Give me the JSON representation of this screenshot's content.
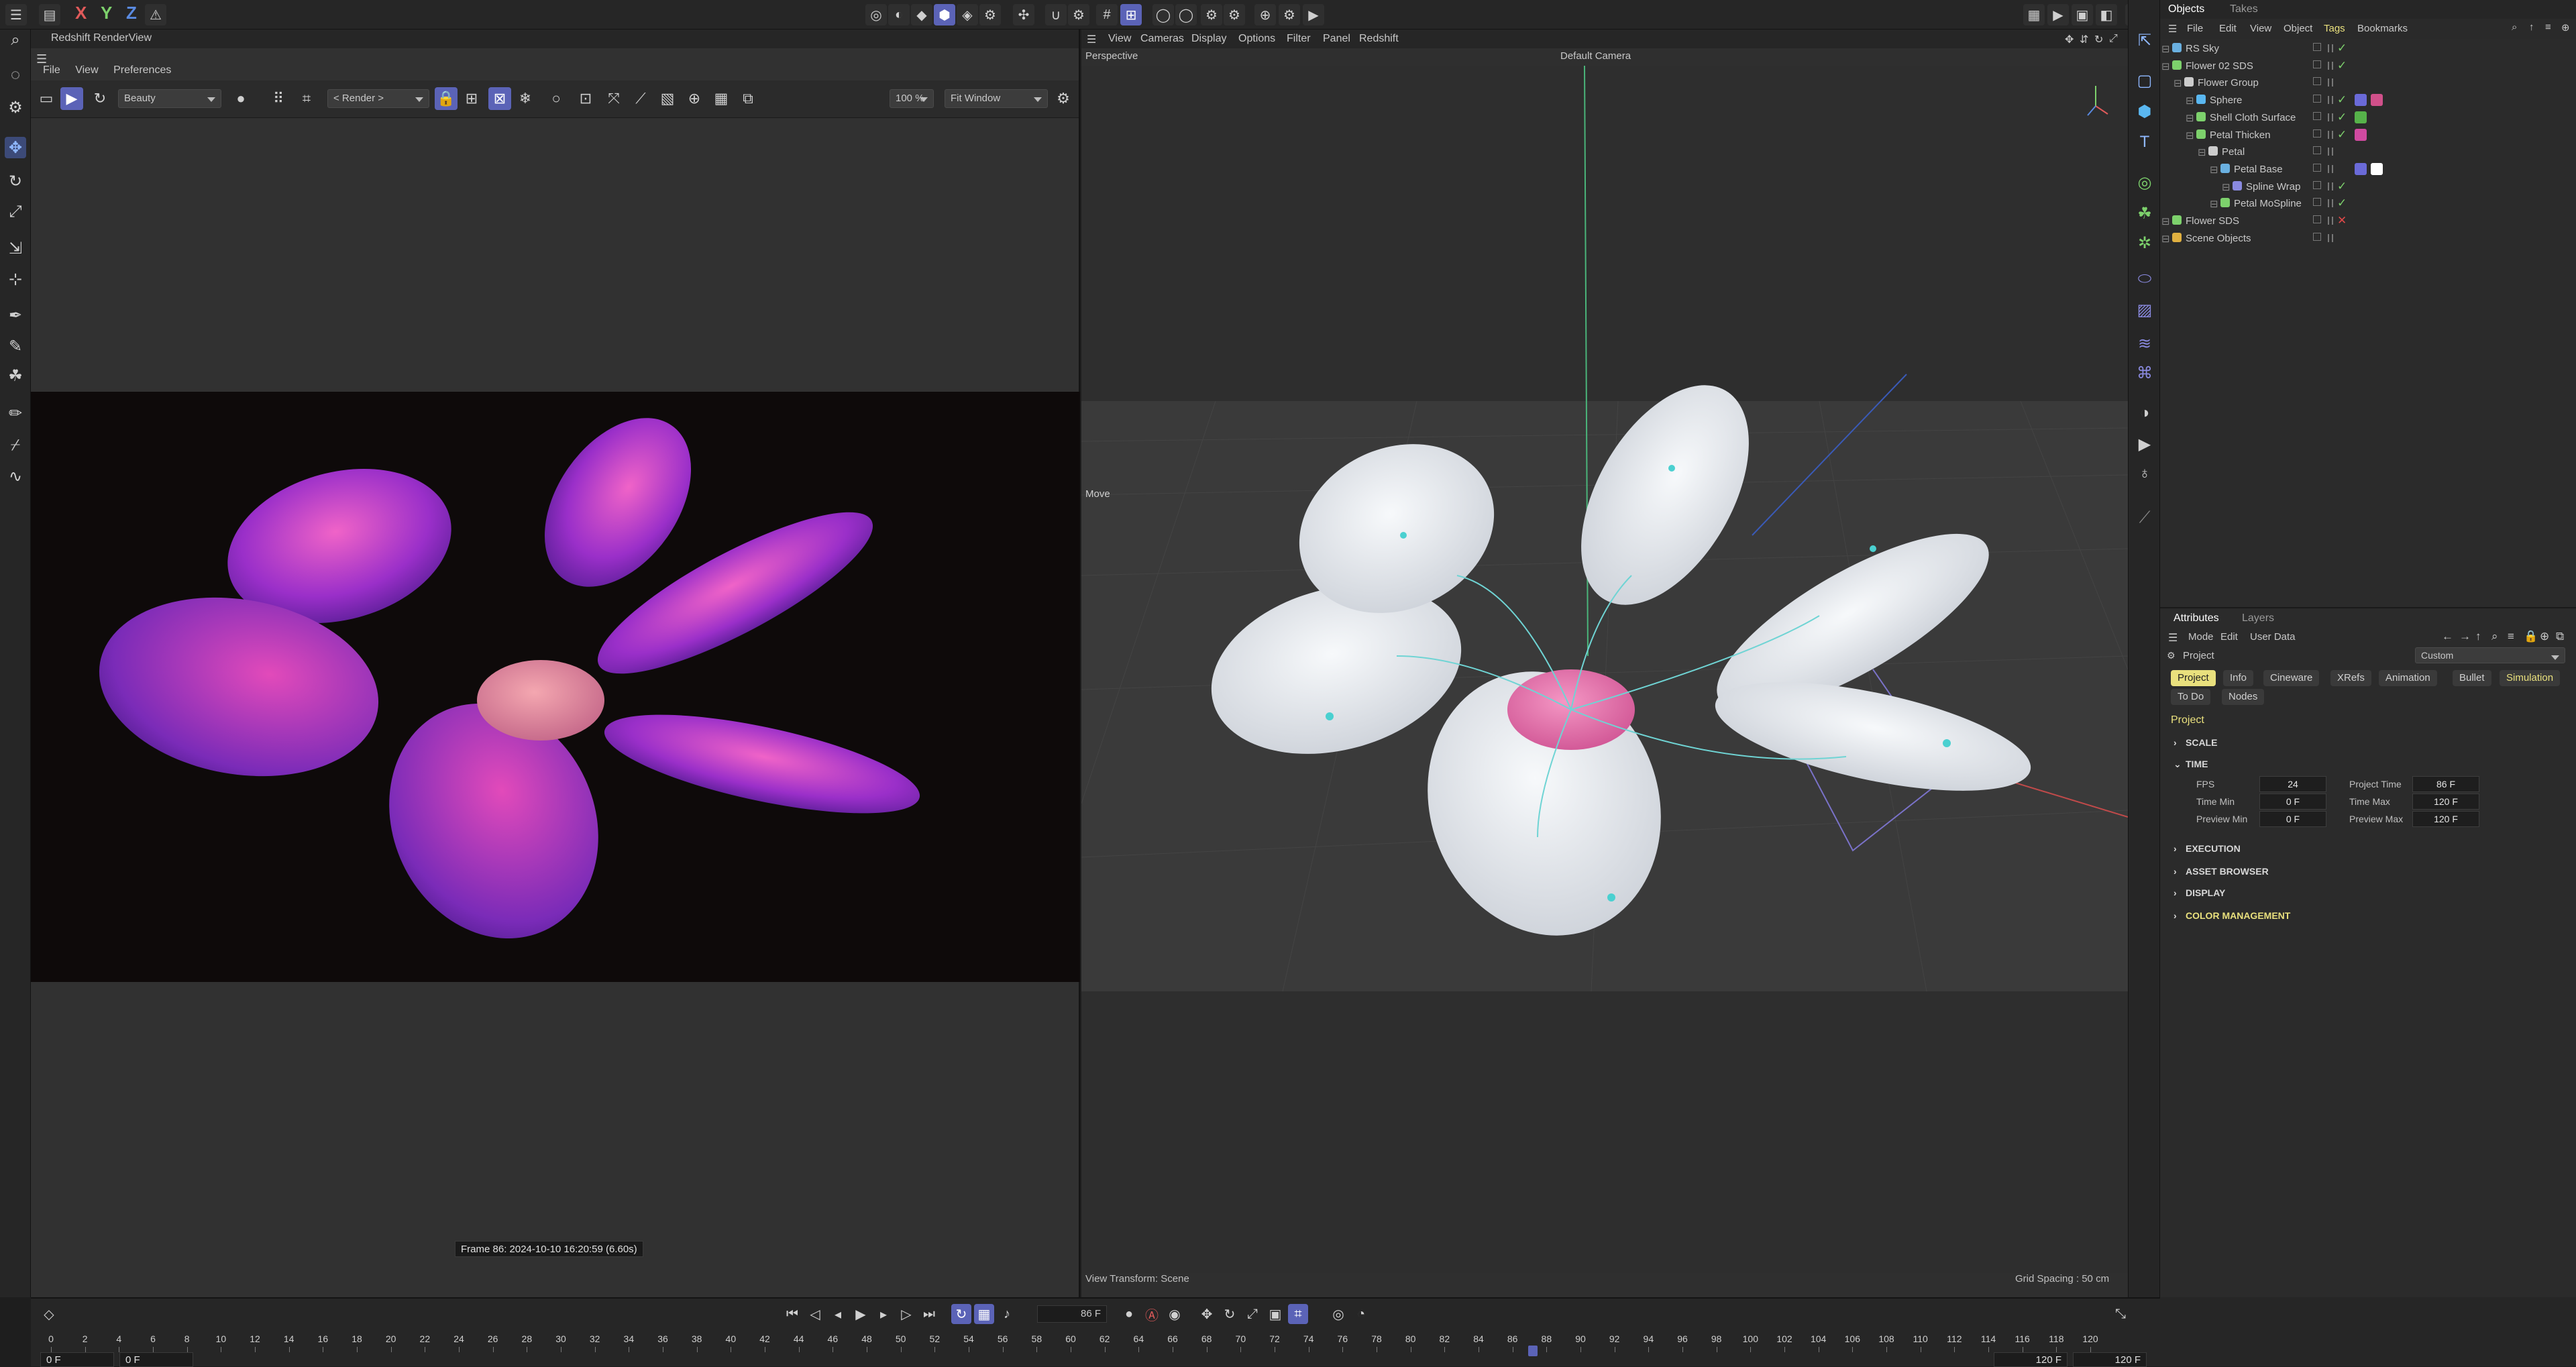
{
  "top": {
    "axis_x": "X",
    "axis_y": "Y",
    "axis_z": "Z"
  },
  "renderview": {
    "title": "Redshift RenderView",
    "menu": [
      "File",
      "View",
      "Preferences"
    ],
    "pass_select": "Beauty",
    "render_select": "< Render >",
    "zoom": "100 %",
    "fit_select": "Fit Window",
    "frame_status": "Frame  86:  2024-10-10  16:20:59  (6.60s)"
  },
  "viewport": {
    "menu": [
      "View",
      "Cameras",
      "Display",
      "Options",
      "Filter",
      "Panel",
      "Redshift"
    ],
    "projection": "Perspective",
    "camera": "Default Camera",
    "move_label": "Move",
    "view_transform": "View Transform: Scene",
    "grid_spacing": "Grid Spacing : 50 cm"
  },
  "objects": {
    "tabs": [
      "Objects",
      "Takes"
    ],
    "menu": [
      "File",
      "Edit",
      "View",
      "Object",
      "Tags",
      "Bookmarks"
    ],
    "rows": [
      {
        "name": "RS Sky",
        "indent": 0,
        "color": "#6ab0e0",
        "status": "check"
      },
      {
        "name": "Flower 02 SDS",
        "indent": 0,
        "color": "#7dd16c",
        "status": "check"
      },
      {
        "name": "Flower Group",
        "indent": 1,
        "color": "#cccccc",
        "status": "none"
      },
      {
        "name": "Sphere",
        "indent": 2,
        "color": "#5ab7f0",
        "status": "check",
        "tags": [
          "#6a6ad8",
          "#d0508a"
        ]
      },
      {
        "name": "Shell Cloth Surface",
        "indent": 2,
        "color": "#7dd16c",
        "status": "check",
        "tags": [
          "#56b24a"
        ]
      },
      {
        "name": "Petal Thicken",
        "indent": 2,
        "color": "#7dd16c",
        "status": "check",
        "tags": [
          "#d04aa0"
        ]
      },
      {
        "name": "Petal",
        "indent": 3,
        "color": "#cccccc",
        "status": "none"
      },
      {
        "name": "Petal Base",
        "indent": 4,
        "color": "#6ab0e0",
        "status": "none",
        "tags": [
          "#6a6ad8",
          "#ffffff"
        ]
      },
      {
        "name": "Spline Wrap",
        "indent": 5,
        "color": "#8a8ae0",
        "status": "check"
      },
      {
        "name": "Petal MoSpline",
        "indent": 4,
        "color": "#7dd16c",
        "status": "check"
      },
      {
        "name": "Flower SDS",
        "indent": 0,
        "color": "#7dd16c",
        "status": "x"
      },
      {
        "name": "Scene Objects",
        "indent": 0,
        "color": "#e0b040",
        "status": "none"
      }
    ]
  },
  "attributes": {
    "tabs": [
      "Attributes",
      "Layers"
    ],
    "menu": [
      "Mode",
      "Edit",
      "User Data"
    ],
    "object_label": "Project",
    "preset": "Custom",
    "chips": [
      "Project",
      "Info",
      "Cineware",
      "XRefs",
      "Animation",
      "Bullet",
      "Simulation",
      "To Do",
      "Nodes"
    ],
    "section_title": "Project",
    "sections": [
      "SCALE",
      "TIME",
      "EXECUTION",
      "ASSET BROWSER",
      "DISPLAY",
      "COLOR MANAGEMENT"
    ],
    "time": {
      "fps_label": "FPS",
      "fps": "24",
      "project_time_label": "Project Time",
      "project_time": "86 F",
      "time_min_label": "Time Min",
      "time_min": "0 F",
      "time_max_label": "Time Max",
      "time_max": "120 F",
      "preview_min_label": "Preview Min",
      "preview_min": "0 F",
      "preview_max_label": "Preview Max",
      "preview_max": "120 F"
    }
  },
  "timeline": {
    "current_frame": "86 F",
    "ticks": [
      "0",
      "2",
      "4",
      "6",
      "8",
      "10",
      "12",
      "14",
      "16",
      "18",
      "20",
      "22",
      "24",
      "26",
      "28",
      "30",
      "32",
      "34",
      "36",
      "38",
      "40",
      "42",
      "44",
      "46",
      "48",
      "50",
      "52",
      "54",
      "56",
      "58",
      "60",
      "62",
      "64",
      "66",
      "68",
      "70",
      "72",
      "74",
      "76",
      "78",
      "80",
      "82",
      "84",
      "86",
      "88",
      "90",
      "92",
      "94",
      "96",
      "98",
      "100",
      "102",
      "104",
      "106",
      "108",
      "110",
      "112",
      "114",
      "116",
      "118",
      "120"
    ],
    "start_a": "0 F",
    "start_b": "0 F",
    "end_a": "120 F",
    "end_b": "120 F"
  }
}
